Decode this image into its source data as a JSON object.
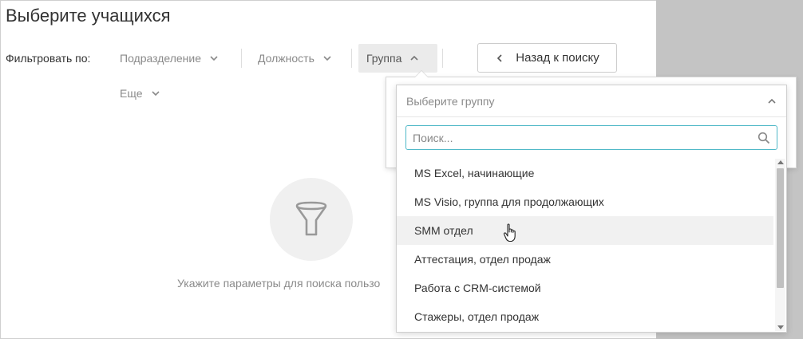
{
  "page": {
    "title": "Выберите учащихся",
    "filter_label": "Фильтровать по:"
  },
  "filters": {
    "division": "Подразделение",
    "position": "Должность",
    "group": "Группа",
    "more": "Еще"
  },
  "back_button": {
    "label": "Назад к поиску"
  },
  "empty_state": {
    "hint": "Укажите параметры для поиска пользо"
  },
  "dropdown": {
    "header": "Выберите группу",
    "search_placeholder": "Поиск...",
    "items": [
      "MS Excel, начинающие",
      "MS Visio, группа для продолжающих",
      "SMM отдел",
      "Аттестация, отдел продаж",
      "Работа с CRM-системой",
      "Стажеры, отдел продаж"
    ],
    "hover_index": 2
  },
  "colors": {
    "search_border": "#4fb8c7",
    "active_filter_bg": "#ebebeb",
    "background": "#c4c4c4"
  }
}
